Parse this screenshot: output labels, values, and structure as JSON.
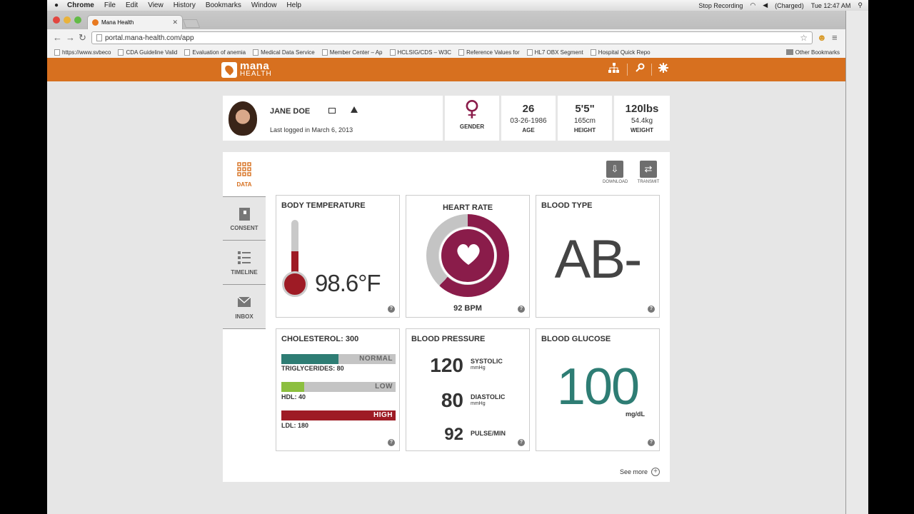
{
  "menubar": {
    "app": "Chrome",
    "items": [
      "File",
      "Edit",
      "View",
      "History",
      "Bookmarks",
      "Window",
      "Help"
    ],
    "stop_recording": "Stop Recording",
    "battery": "(Charged)",
    "clock": "Tue 12:47 AM"
  },
  "browser": {
    "tab_title": "Mana Health",
    "url": "portal.mana-health.com/app",
    "bookmarks": [
      "https://www.svbeco",
      "CDA Guideline Valid",
      "Evaluation of anemia",
      "Medical Data Service",
      "Member Center – Ap",
      "HCLSIG/CDS – W3C",
      "Reference Values for",
      "HL7 OBX Segment",
      "Hospital Quick Repo"
    ],
    "other_bookmarks": "Other Bookmarks"
  },
  "header": {
    "logo_line1": "mana",
    "logo_line2": "HEALTH",
    "icons": [
      "sitemap-icon",
      "search-icon",
      "gear-icon"
    ]
  },
  "patient": {
    "name": "JANE DOE",
    "last_logged": "Last logged in March 6, 2013",
    "gender_label": "GENDER",
    "gender_symbol": "♀",
    "age_value": "26",
    "dob": "03-26-1986",
    "age_label": "AGE",
    "height_value": "5'5\"",
    "height_metric": "165cm",
    "height_label": "HEIGHT",
    "weight_value": "120lbs",
    "weight_metric": "54.4kg",
    "weight_label": "WEIGHT"
  },
  "sidenav": {
    "data": "DATA",
    "consent": "CONSENT",
    "timeline": "TIMELINE",
    "inbox": "INBOX"
  },
  "actions": {
    "download": "DOWNLOAD",
    "transmit": "TRANSMIT"
  },
  "cards": {
    "body_temperature": {
      "title": "BODY TEMPERATURE",
      "value": "98.6°F",
      "fill_fraction": 0.45
    },
    "heart_rate": {
      "title": "HEART RATE",
      "value": "92 BPM",
      "ring_fraction": 0.62
    },
    "blood_type": {
      "title": "BLOOD TYPE",
      "value": "AB-"
    },
    "cholesterol": {
      "title": "CHOLESTEROL: 300",
      "rows": [
        {
          "tag": "NORMAL",
          "label": "TRIGLYCERIDES: 80",
          "fraction": 0.5,
          "color": "#2e7d74"
        },
        {
          "tag": "LOW",
          "label": "HDL: 40",
          "fraction": 0.2,
          "color": "#8cbf3f"
        },
        {
          "tag": "HIGH",
          "label": "LDL: 180",
          "fraction": 1.0,
          "color": "#9e1b25"
        }
      ]
    },
    "blood_pressure": {
      "title": "BLOOD PRESSURE",
      "systolic_value": "120",
      "systolic_label": "SYSTOLIC",
      "systolic_unit": "mmHg",
      "diastolic_value": "80",
      "diastolic_label": "DIASTOLIC",
      "diastolic_unit": "mmHg",
      "pulse_value": "92",
      "pulse_label": "PULSE/MIN"
    },
    "blood_glucose": {
      "title": "BLOOD GLUCOSE",
      "value": "100",
      "unit": "mg/dL"
    }
  },
  "help_glyph": "?",
  "see_more": "See more",
  "colors": {
    "brand_orange": "#d7701f",
    "heart_maroon": "#8a1c4a",
    "thermo_red": "#9e1b25",
    "glucose_teal": "#2e7d74"
  }
}
